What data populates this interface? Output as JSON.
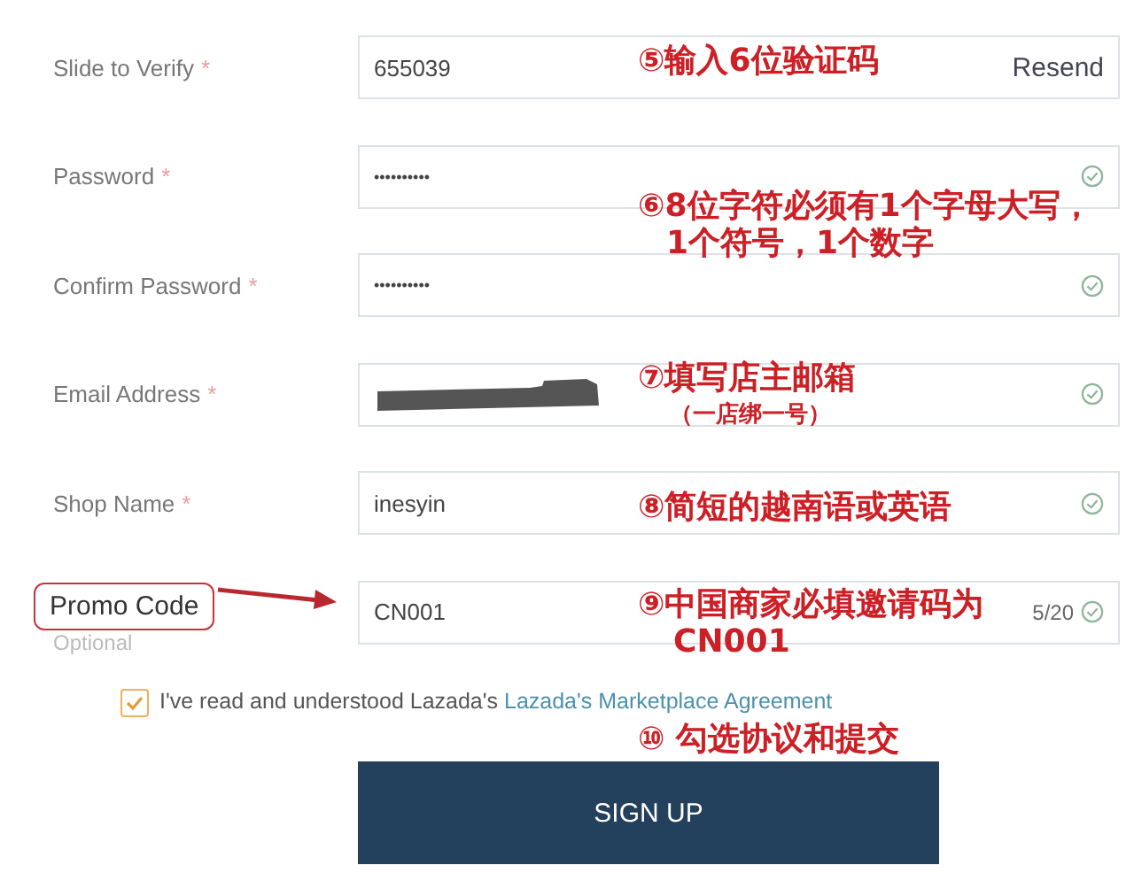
{
  "fields": [
    {
      "label": "Slide to Verify",
      "required_mark": "*",
      "kind": "text",
      "value": "655039",
      "action": "Resend",
      "valid": false
    },
    {
      "label": "Password",
      "required_mark": "*",
      "kind": "password",
      "value": "••••••••••",
      "valid": true
    },
    {
      "label": "Confirm Password",
      "required_mark": "*",
      "kind": "password",
      "value": "••••••••••",
      "valid": true
    },
    {
      "label": "Email Address",
      "required_mark": "*",
      "kind": "redacted",
      "valid": true
    },
    {
      "label": "Shop Name",
      "required_mark": "*",
      "kind": "text",
      "value": "inesyin",
      "valid": true
    },
    {
      "label": "Promo Code",
      "hint": "Optional",
      "highlighted": true,
      "kind": "text",
      "value": "CN001",
      "counter": "5/20",
      "valid": true
    }
  ],
  "agreement": {
    "checked": true,
    "text": "I've read and understood Lazada's",
    "link": "Lazada's Marketplace Agreement"
  },
  "submit": "SIGN UP",
  "notes": [
    {
      "lines": [
        "⑤输入6位验证码"
      ]
    },
    {
      "lines": [
        "⑥8位字符必须有1个字母大写，",
        "1个符号，1个数字"
      ]
    },
    {
      "lines": [
        "⑦填写店主邮箱",
        "（一店绑一号）"
      ]
    },
    {
      "lines": [
        "⑧简短的越南语或英语"
      ]
    },
    {
      "lines": [
        "⑨中国商家必填邀请码为",
        "CN001"
      ]
    },
    {
      "lines": [
        "⑩ 勾选协议和提交"
      ]
    }
  ]
}
